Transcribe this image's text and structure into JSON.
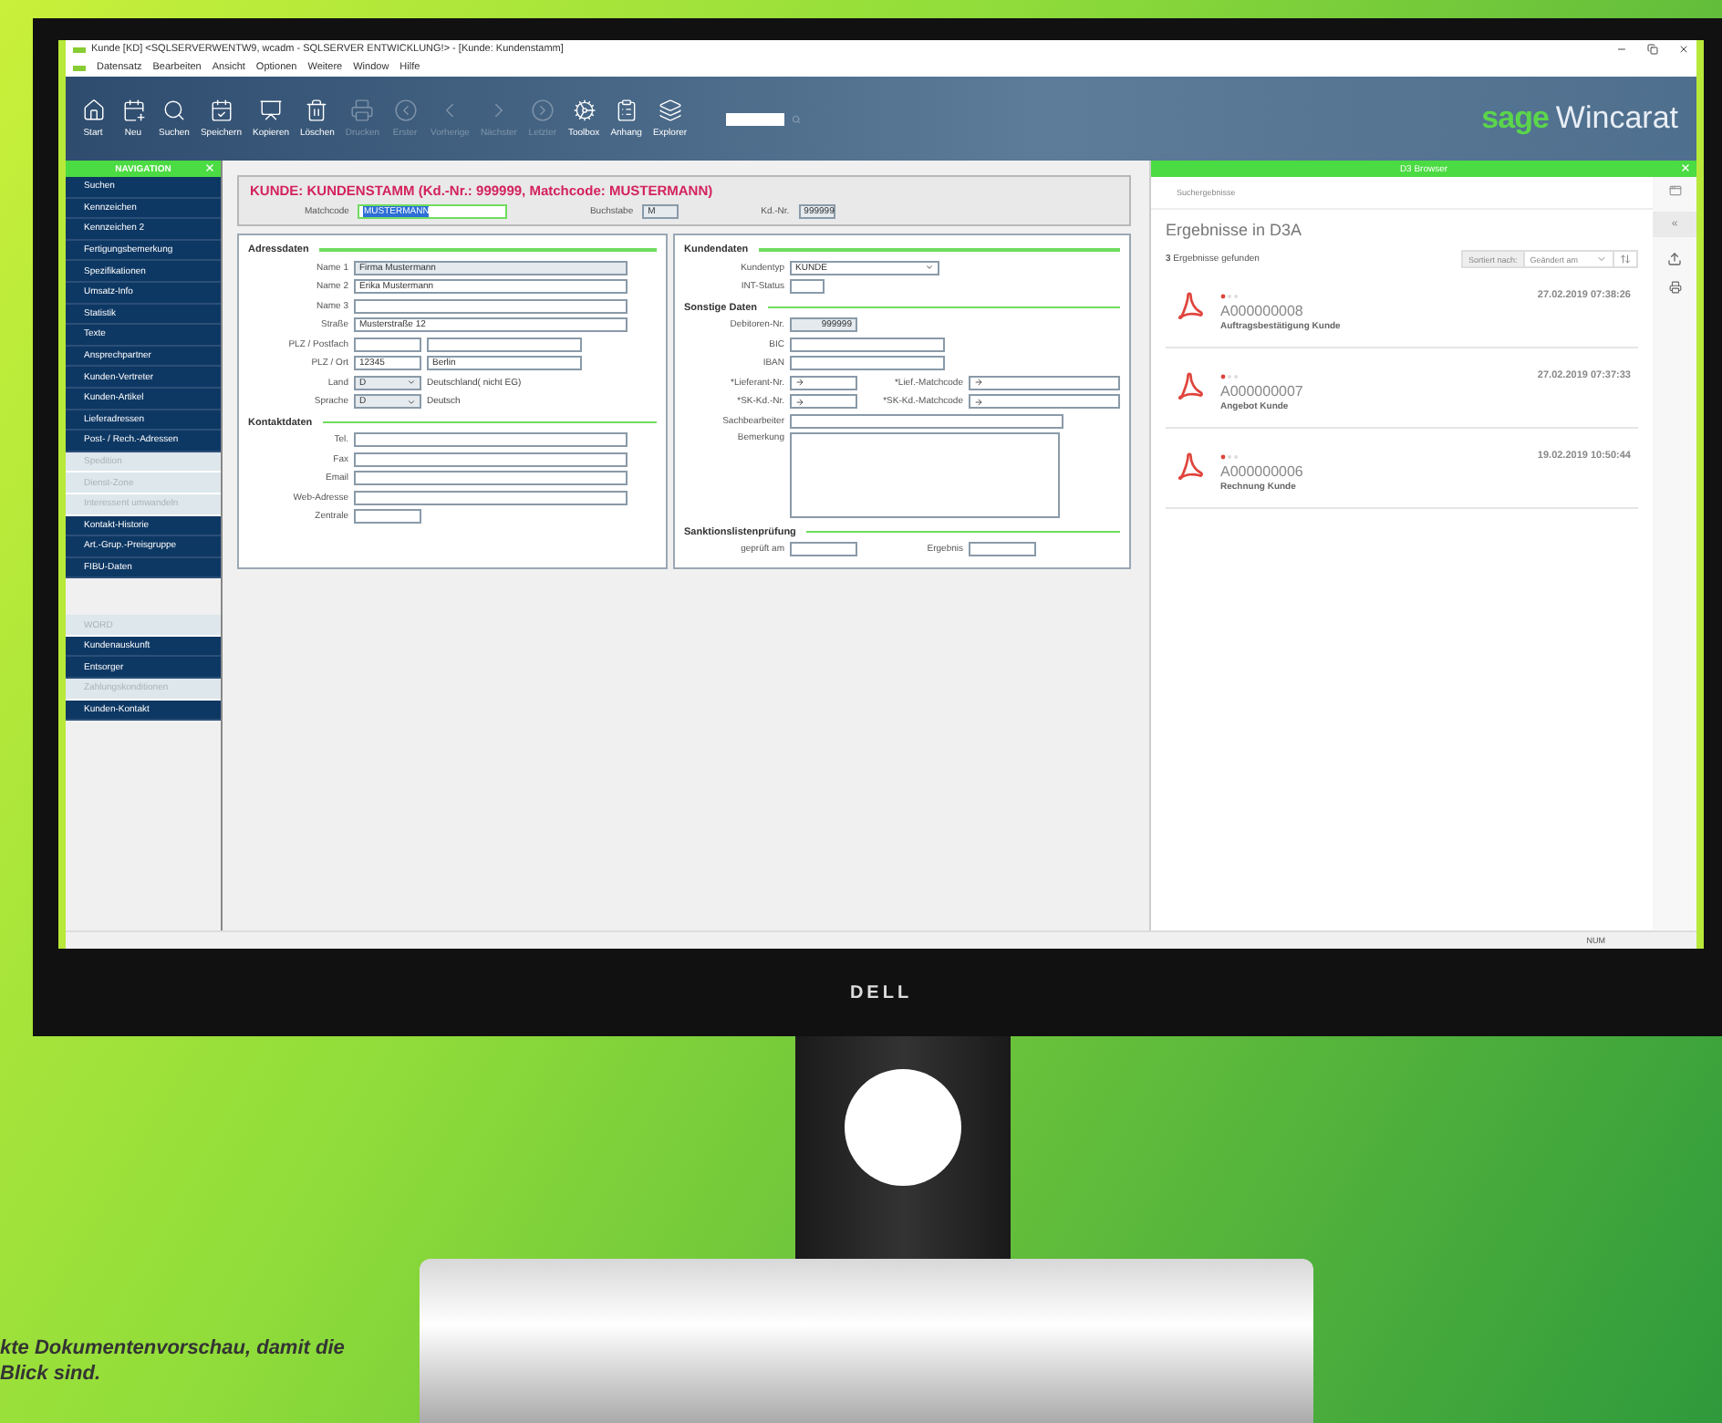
{
  "window": {
    "title": "Kunde [KD] <SQLSERVERWENTW9, wcadm - SQLSERVER ENTWICKLUNG!> - [Kunde: Kundenstamm]"
  },
  "menu": [
    "Datensatz",
    "Bearbeiten",
    "Ansicht",
    "Optionen",
    "Weitere",
    "Window",
    "Hilfe"
  ],
  "toolbar": [
    {
      "label": "Start",
      "disabled": false
    },
    {
      "label": "Neu",
      "disabled": false
    },
    {
      "label": "Suchen",
      "disabled": false
    },
    {
      "label": "Speichern",
      "disabled": false
    },
    {
      "label": "Kopieren",
      "disabled": false
    },
    {
      "label": "Löschen",
      "disabled": false
    },
    {
      "label": "Drucken",
      "disabled": true
    },
    {
      "label": "Erster",
      "disabled": true
    },
    {
      "label": "Vorherige",
      "disabled": true
    },
    {
      "label": "Nächster",
      "disabled": true
    },
    {
      "label": "Letzter",
      "disabled": true
    },
    {
      "label": "Toolbox",
      "disabled": false
    },
    {
      "label": "Anhang",
      "disabled": false
    },
    {
      "label": "Explorer",
      "disabled": false
    }
  ],
  "logo": {
    "brand": "sage",
    "product": "Wincarat"
  },
  "navigation": {
    "title": "NAVIGATION",
    "groups": [
      [
        {
          "label": "Suchen",
          "disabled": false
        },
        {
          "label": "Kennzeichen",
          "disabled": false
        },
        {
          "label": "Kennzeichen 2",
          "disabled": false
        },
        {
          "label": "Fertigungsbemerkung",
          "disabled": false
        },
        {
          "label": "Spezifikationen",
          "disabled": false
        },
        {
          "label": "Umsatz-Info",
          "disabled": false
        },
        {
          "label": "Statistik",
          "disabled": false
        },
        {
          "label": "Texte",
          "disabled": false
        },
        {
          "label": "Ansprechpartner",
          "disabled": false
        },
        {
          "label": "Kunden-Vertreter",
          "disabled": false
        },
        {
          "label": "Kunden-Artikel",
          "disabled": false
        },
        {
          "label": "Lieferadressen",
          "disabled": false
        },
        {
          "label": "Post- / Rech.-Adressen",
          "disabled": false
        },
        {
          "label": "Spedition",
          "disabled": true
        },
        {
          "label": "Dienst-Zone",
          "disabled": true
        },
        {
          "label": "Interessent umwandeln",
          "disabled": true
        },
        {
          "label": "Kontakt-Historie",
          "disabled": false
        },
        {
          "label": "Art.-Grup.-Preisgruppe",
          "disabled": false
        },
        {
          "label": "FIBU-Daten",
          "disabled": false
        }
      ],
      [
        {
          "label": "WORD",
          "disabled": true
        },
        {
          "label": "Kundenauskunft",
          "disabled": false
        },
        {
          "label": "Entsorger",
          "disabled": false
        },
        {
          "label": "Zahlungskonditionen",
          "disabled": true
        },
        {
          "label": "Kunden-Kontakt",
          "disabled": false
        }
      ]
    ]
  },
  "form": {
    "title": "KUNDE: KUNDENSTAMM (Kd.-Nr.: 999999, Matchcode: MUSTERMANN)",
    "header_fields": [
      {
        "label": "Matchcode",
        "value": "MUSTERMANN",
        "kind": "focused"
      },
      {
        "label": "Buchstabe",
        "value": "M",
        "kind": "readonly"
      },
      {
        "label": "Kd.-Nr.",
        "value": "999999",
        "kind": "readonly"
      }
    ],
    "columns": [
      [
        {
          "title": "Adressdaten",
          "rows": [
            {
              "label": "Name 1",
              "fields": [
                {
                  "kind": "wide",
                  "value": "Firma Mustermann",
                  "readonly": true
                }
              ]
            },
            {
              "label": "Name 2",
              "fields": [
                {
                  "kind": "wide",
                  "value": "Erika Mustermann",
                  "readonly": false
                }
              ]
            },
            {
              "label": "Name 3",
              "fields": [
                {
                  "kind": "wide",
                  "readonly": false
                }
              ]
            },
            {
              "label": "Straße",
              "fields": [
                {
                  "kind": "wide",
                  "value": "Musterstraße 12",
                  "readonly": false
                }
              ]
            },
            {
              "label": "PLZ / Postfach",
              "fields": [
                {
                  "kind": "short",
                  "readonly": false
                },
                {
                  "kind": "medium",
                  "readonly": false
                }
              ]
            },
            {
              "label": "PLZ / Ort",
              "fields": [
                {
                  "kind": "short",
                  "value": "12345",
                  "readonly": false
                },
                {
                  "kind": "medium",
                  "value": "Berlin",
                  "readonly": false
                }
              ]
            },
            {
              "label": "Land",
              "fields": [
                {
                  "kind": "select",
                  "value": "D",
                  "readonly": true
                }
              ],
              "note": "Deutschland( nicht EG)"
            },
            {
              "label": "Sprache",
              "fields": [
                {
                  "kind": "select",
                  "value": "D",
                  "readonly": true
                }
              ],
              "note": "Deutsch"
            }
          ]
        },
        {
          "title": "Kontaktdaten",
          "rows": [
            {
              "label": "Tel.",
              "fields": [
                {
                  "kind": "wide",
                  "readonly": false
                }
              ]
            },
            {
              "label": "Fax",
              "fields": [
                {
                  "kind": "wide",
                  "readonly": false
                }
              ]
            },
            {
              "label": "Email",
              "fields": [
                {
                  "kind": "wide",
                  "readonly": false
                }
              ]
            },
            {
              "label": "Web-Adresse",
              "fields": [
                {
                  "kind": "wide",
                  "readonly": false
                }
              ]
            },
            {
              "label": "Zentrale",
              "fields": [
                {
                  "kind": "short",
                  "readonly": false
                }
              ]
            }
          ]
        }
      ],
      [
        {
          "title": "Kundendaten",
          "rows": [
            {
              "label": "Kundentyp",
              "fields": [
                {
                  "kind": "select-wide",
                  "value": "KUNDE",
                  "readonly": false
                }
              ]
            },
            {
              "label": "INT-Status",
              "fields": [
                {
                  "kind": "tiny",
                  "readonly": false
                }
              ]
            }
          ]
        },
        {
          "title": "Sonstige Daten",
          "rows": [
            {
              "label": "Debitoren-Nr.",
              "fields": [
                {
                  "kind": "number",
                  "value": "999999",
                  "readonly": true
                }
              ]
            },
            {
              "label": "BIC",
              "fields": [
                {
                  "kind": "medium",
                  "readonly": false
                }
              ]
            },
            {
              "label": "IBAN",
              "fields": [
                {
                  "kind": "medium",
                  "readonly": false
                }
              ]
            },
            {
              "label": "*Lieferant-Nr.",
              "fields": [
                {
                  "kind": "lookup",
                  "readonly": false
                },
                {
                  "kind": "lookup-wide",
                  "label": "*Lief.-Matchcode",
                  "readonly": false
                }
              ]
            },
            {
              "label": "*SK-Kd.-Nr.",
              "fields": [
                {
                  "kind": "lookup",
                  "readonly": false
                },
                {
                  "kind": "lookup-wide",
                  "label": "*SK-Kd.-Matchcode",
                  "readonly": false
                }
              ]
            },
            {
              "label": "Sachbearbeiter",
              "fields": [
                {
                  "kind": "wide",
                  "readonly": false
                }
              ]
            },
            {
              "label": "Bemerkung",
              "fields": [
                {
                  "kind": "textarea",
                  "readonly": false
                }
              ]
            }
          ]
        },
        {
          "title": "Sanktionslistenprüfung",
          "rows": [
            {
              "label": "geprüft am",
              "fields": [
                {
                  "kind": "short",
                  "readonly": false
                },
                {
                  "kind": "short",
                  "label": "Ergebnis",
                  "readonly": false
                }
              ]
            }
          ]
        }
      ]
    ]
  },
  "d3_browser": {
    "title": "D3 Browser",
    "breadcrumb": "Suchergebnisse",
    "heading": "Ergebnisse in D3A",
    "count": "**3** Ergebnisse gefunden",
    "sort_label": "Sortiert nach:",
    "sort_value": "Geändert am",
    "results": [
      {
        "id": "A000000008",
        "name": "Auftragsbestätigung Kunde",
        "date": "27.02.2019 07:38:26"
      },
      {
        "id": "A000000007",
        "name": "Angebot Kunde",
        "date": "27.02.2019 07:37:33"
      },
      {
        "id": "A000000006",
        "name": "Rechnung Kunde",
        "date": "19.02.2019 10:50:44"
      }
    ],
    "collapse": "«"
  },
  "status_bar": {
    "num": "NUM"
  },
  "monitor": {
    "brand": "DELL"
  },
  "caption": [
    "kte Dokumentenvorschau, damit die",
    "Blick sind."
  ]
}
